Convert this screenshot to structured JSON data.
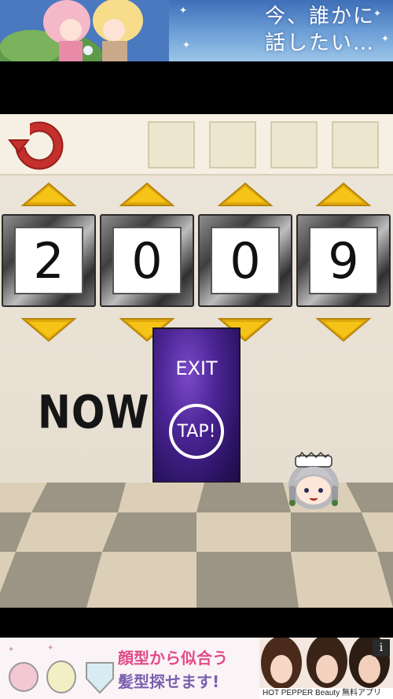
{
  "top_ad": {
    "headline": "今、誰かに\n話したい…"
  },
  "toolbar": {
    "reset_icon": "rotate-left-icon",
    "slots": [
      "",
      "",
      "",
      ""
    ]
  },
  "lock": {
    "digits": [
      "2",
      "0",
      "0",
      "9"
    ],
    "up_arrow_icon": "triangle-up-icon",
    "down_arrow_icon": "triangle-down-icon",
    "arrow_color": "#f6c417",
    "frame_color": "#3c3c3c"
  },
  "scene": {
    "now_label": "NOW",
    "door": {
      "exit_label": "EXIT",
      "tap_label": "TAP!",
      "color": "#4b2594"
    },
    "character_icon": "maid-character-icon"
  },
  "bottom_ad": {
    "line1": "顔型から似合う",
    "line2": "髪型探せます!",
    "brand": "HOT PEPPER Beauty 無料アプリ",
    "info_icon": "info-icon",
    "info_label": "i"
  }
}
